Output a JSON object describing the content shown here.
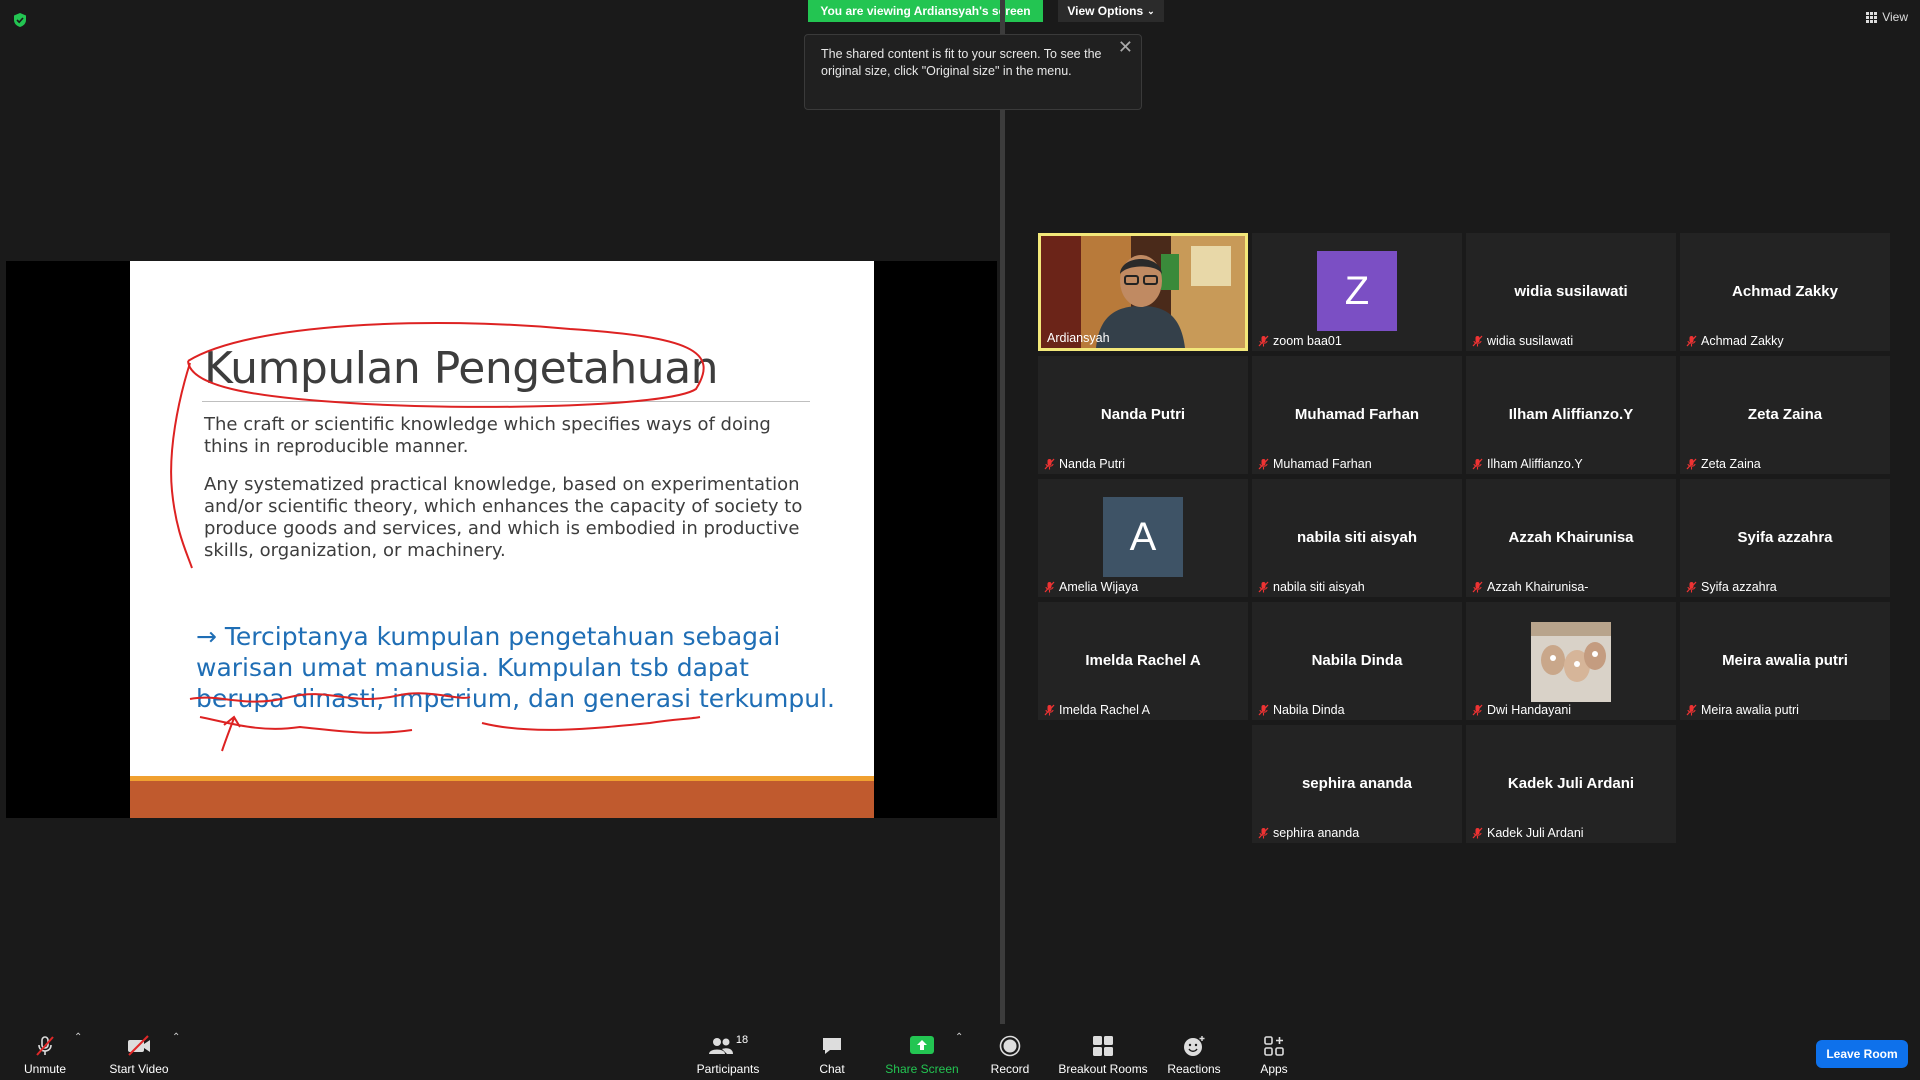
{
  "banner": {
    "viewing": "You are viewing Ardiansyah's screen",
    "view_options": "View Options",
    "view": "View"
  },
  "tooltip": {
    "text": "The shared content is fit to your screen. To see the original size, click \"Original size\" in the menu."
  },
  "slide": {
    "title": "Kumpulan Pengetahuan",
    "p1": "The craft or scientific knowledge which specifies ways of doing thins in reproducible manner.",
    "p2": "Any systematized practical knowledge, based on experimentation and/or scientific theory, which enhances the capacity of society to produce goods and services, and which is embodied in productive skills, organization, or machinery.",
    "p3": "→ Terciptanya kumpulan pengetahuan sebagai warisan umat manusia. Kumpulan tsb dapat berupa dinasti, imperium, dan generasi terkumpul."
  },
  "participants": [
    {
      "label": "Ardiansyah",
      "big": "",
      "type": "video",
      "muted": false
    },
    {
      "label": "zoom baa01",
      "big": "",
      "type": "letter",
      "letter": "Z",
      "color": "#7b4fc4",
      "muted": true
    },
    {
      "label": "widia susilawati",
      "big": "widia susilawati",
      "type": "name",
      "muted": true
    },
    {
      "label": "Achmad Zakky",
      "big": "Achmad Zakky",
      "type": "name",
      "muted": true
    },
    {
      "label": "Nanda Putri",
      "big": "Nanda Putri",
      "type": "name",
      "muted": true
    },
    {
      "label": "Muhamad Farhan",
      "big": "Muhamad Farhan",
      "type": "name",
      "muted": true
    },
    {
      "label": "Ilham Aliffianzo.Y",
      "big": "Ilham Aliffianzo.Y",
      "type": "name",
      "muted": true
    },
    {
      "label": "Zeta Zaina",
      "big": "Zeta Zaina",
      "type": "name",
      "muted": true
    },
    {
      "label": "Amelia Wijaya",
      "big": "",
      "type": "letter",
      "letter": "A",
      "color": "#3e5366",
      "muted": true
    },
    {
      "label": "nabila siti aisyah",
      "big": "nabila siti aisyah",
      "type": "name",
      "muted": true
    },
    {
      "label": "Azzah Khairunisa-",
      "big": "Azzah Khairunisa",
      "type": "name",
      "muted": true
    },
    {
      "label": "Syifa azzahra",
      "big": "Syifa azzahra",
      "type": "name",
      "muted": true
    },
    {
      "label": "Imelda Rachel A",
      "big": "Imelda Rachel A",
      "type": "name",
      "muted": true
    },
    {
      "label": "Nabila Dinda",
      "big": "Nabila Dinda",
      "type": "name",
      "muted": true
    },
    {
      "label": "Dwi Handayani",
      "big": "",
      "type": "photo",
      "muted": true
    },
    {
      "label": "Meira awalia putri",
      "big": "Meira awalia putri",
      "type": "name",
      "muted": true
    },
    {
      "label": "sephira ananda",
      "big": "sephira ananda",
      "type": "name",
      "muted": true
    },
    {
      "label": "Kadek Juli Ardani",
      "big": "Kadek Juli Ardani",
      "type": "name",
      "muted": true
    }
  ],
  "toolbar": {
    "unmute": "Unmute",
    "start_video": "Start Video",
    "participants": "Participants",
    "participants_count": "18",
    "chat": "Chat",
    "share_screen": "Share Screen",
    "record": "Record",
    "breakout_rooms": "Breakout Rooms",
    "reactions": "Reactions",
    "apps": "Apps",
    "leave_room": "Leave Room"
  },
  "colors": {
    "accent_green": "#23c552",
    "leave_blue": "#0e71eb",
    "active_speaker": "#f3e87a",
    "slide_text_blue": "#1f6eb5",
    "slide_bar": "#c05a2e"
  }
}
